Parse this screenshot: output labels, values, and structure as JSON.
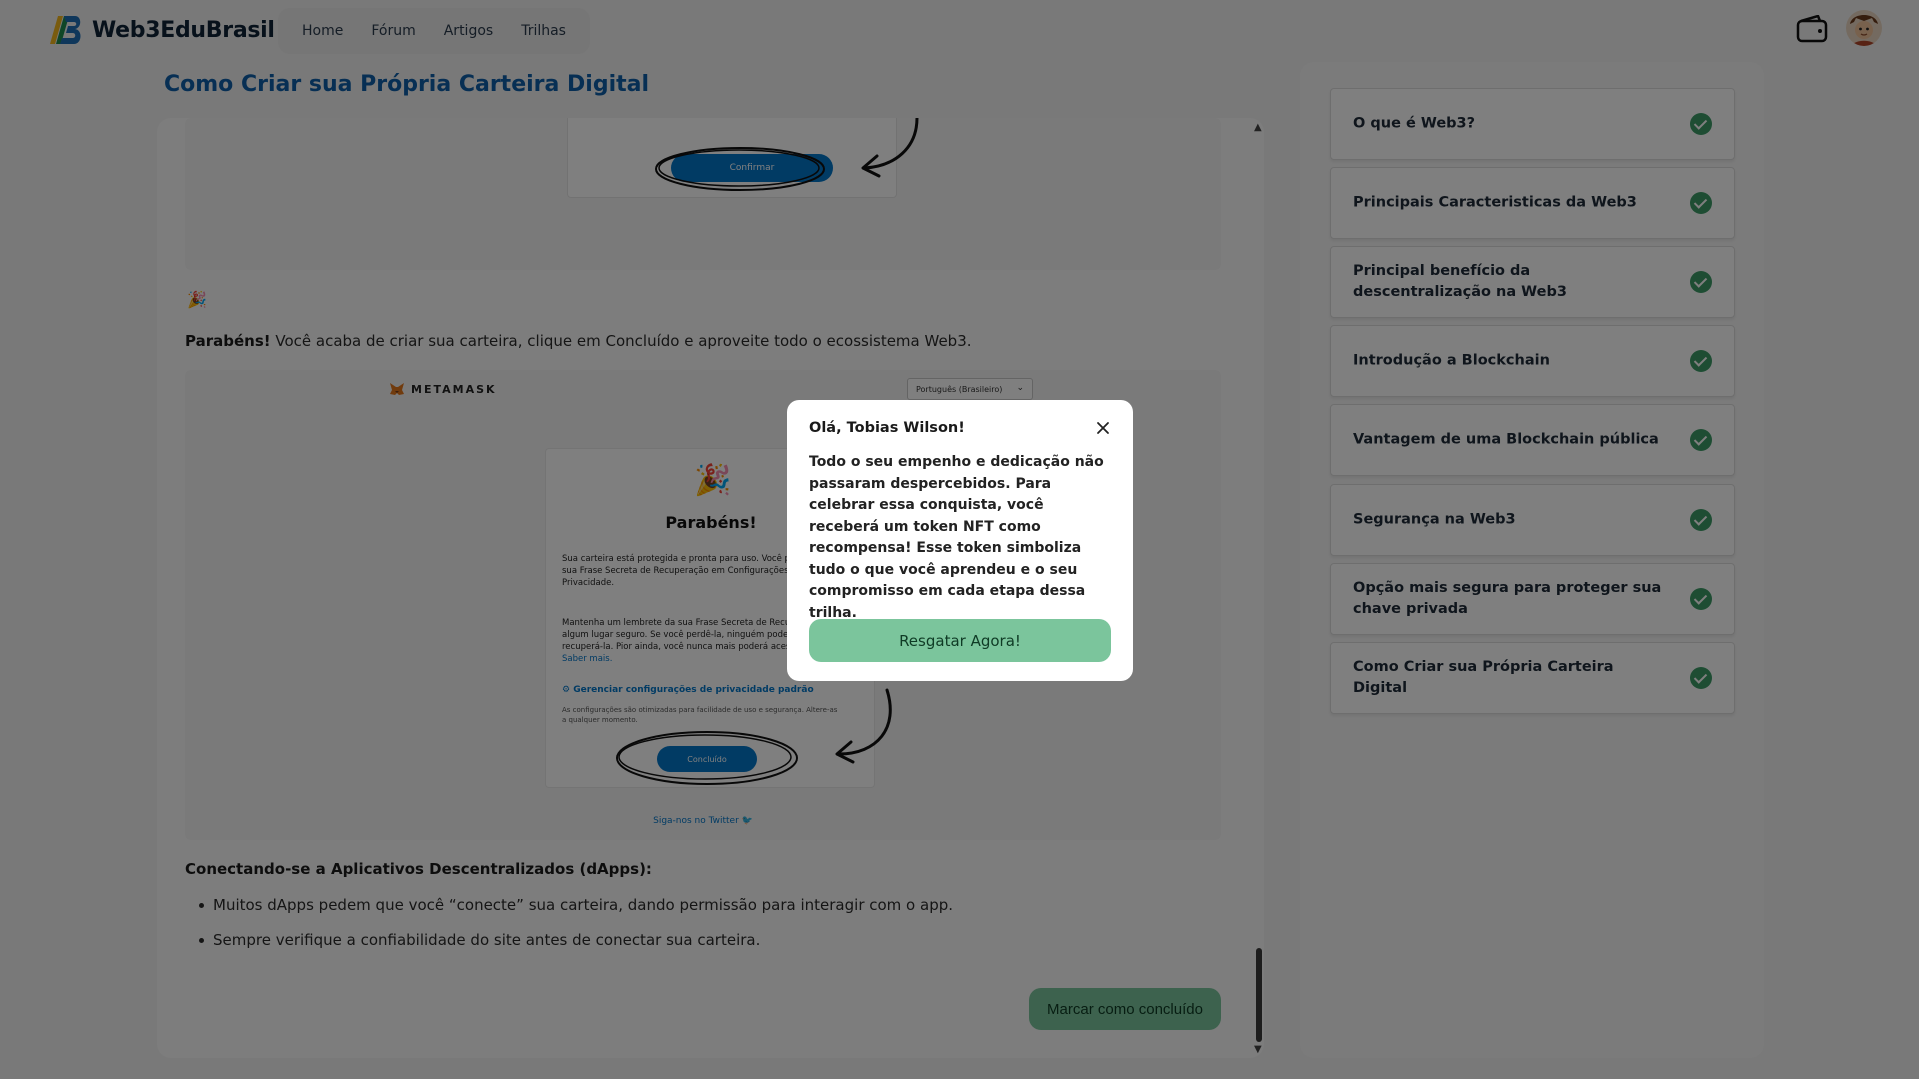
{
  "brand": {
    "name": "Web3EduBrasil"
  },
  "nav": [
    "Home",
    "Fórum",
    "Artigos",
    "Trilhas"
  ],
  "page": {
    "title": "Como Criar sua Própria Carteira Digital",
    "congrats_strong": "Parabéns!",
    "congrats_text": " Você acaba de criar sua carteira, clique em Concluído e aproveite todo o ecossistema Web3.",
    "section_heading": "Conectando-se a Aplicativos Descentralizados (dApps):",
    "bullets": [
      "Muitos dApps pedem que você “conecte” sua carteira, dando permissão para interagir com o app.",
      "Sempre verifique a confiabilidade do site antes de conectar sua carteira."
    ],
    "done_button": "Marcar como concluído"
  },
  "embedded_top": {
    "confirm_label": "Confirmar"
  },
  "embedded_main": {
    "brand": "METAMASK",
    "language": "Português (Brasileiro)",
    "title": "Parabéns!",
    "text1": "Sua carteira está protegida e pronta para uso. Você pode encontrar sua Frase Secreta de Recuperação em Configurações > Segurança e Privacidade.",
    "text2": "Mantenha um lembrete da sua Frase Secreta de Recuperação em algum lugar seguro. Se você perdê-la, ninguém poderá ajudá-lo a recuperá-la. Pior ainda, você nunca mais poderá acessar sua carteira.",
    "learn_more": "Saber mais.",
    "privacy_link": "⚙ Gerenciar configurações de privacidade padrão",
    "privacy_note": "As configurações são otimizadas para facilidade de uso e segurança. Altere-as a qualquer momento.",
    "done_label": "Concluído",
    "twitter": "Siga-nos no Twitter"
  },
  "sidebar": {
    "items": [
      {
        "label": "O que é Web3?",
        "completed": true
      },
      {
        "label": "Principais Caracteristicas da Web3",
        "completed": true
      },
      {
        "label": "Principal benefício da descentralização na Web3",
        "completed": true
      },
      {
        "label": "Introdução a Blockchain",
        "completed": true
      },
      {
        "label": "Vantagem de uma Blockchain pública",
        "completed": true
      },
      {
        "label": "Segurança na Web3",
        "completed": true
      },
      {
        "label": "Opção mais segura para proteger sua chave privada",
        "completed": true
      },
      {
        "label": "Como Criar sua Própria Carteira Digital",
        "completed": true
      }
    ]
  },
  "modal": {
    "title": "Olá, Tobias Wilson!",
    "body": "Todo o seu empenho e dedicação não passaram despercebidos. Para celebrar essa conquista, você receberá um token NFT como recompensa! Esse token simboliza tudo o que você aprendeu e o seu compromisso em cada etapa dessa trilha.",
    "button": "Resgatar Agora!"
  },
  "colors": {
    "accent_green": "#7bc59c",
    "check_green": "#3c9a66",
    "title_blue": "#0e5fa8",
    "metamask_blue": "#0376c9"
  },
  "icons": [
    "logo-icon",
    "wallet-icon",
    "avatar",
    "close-icon",
    "check-icon",
    "party-popper-icon",
    "fox-icon",
    "chevron-down-icon",
    "twitter-icon"
  ]
}
